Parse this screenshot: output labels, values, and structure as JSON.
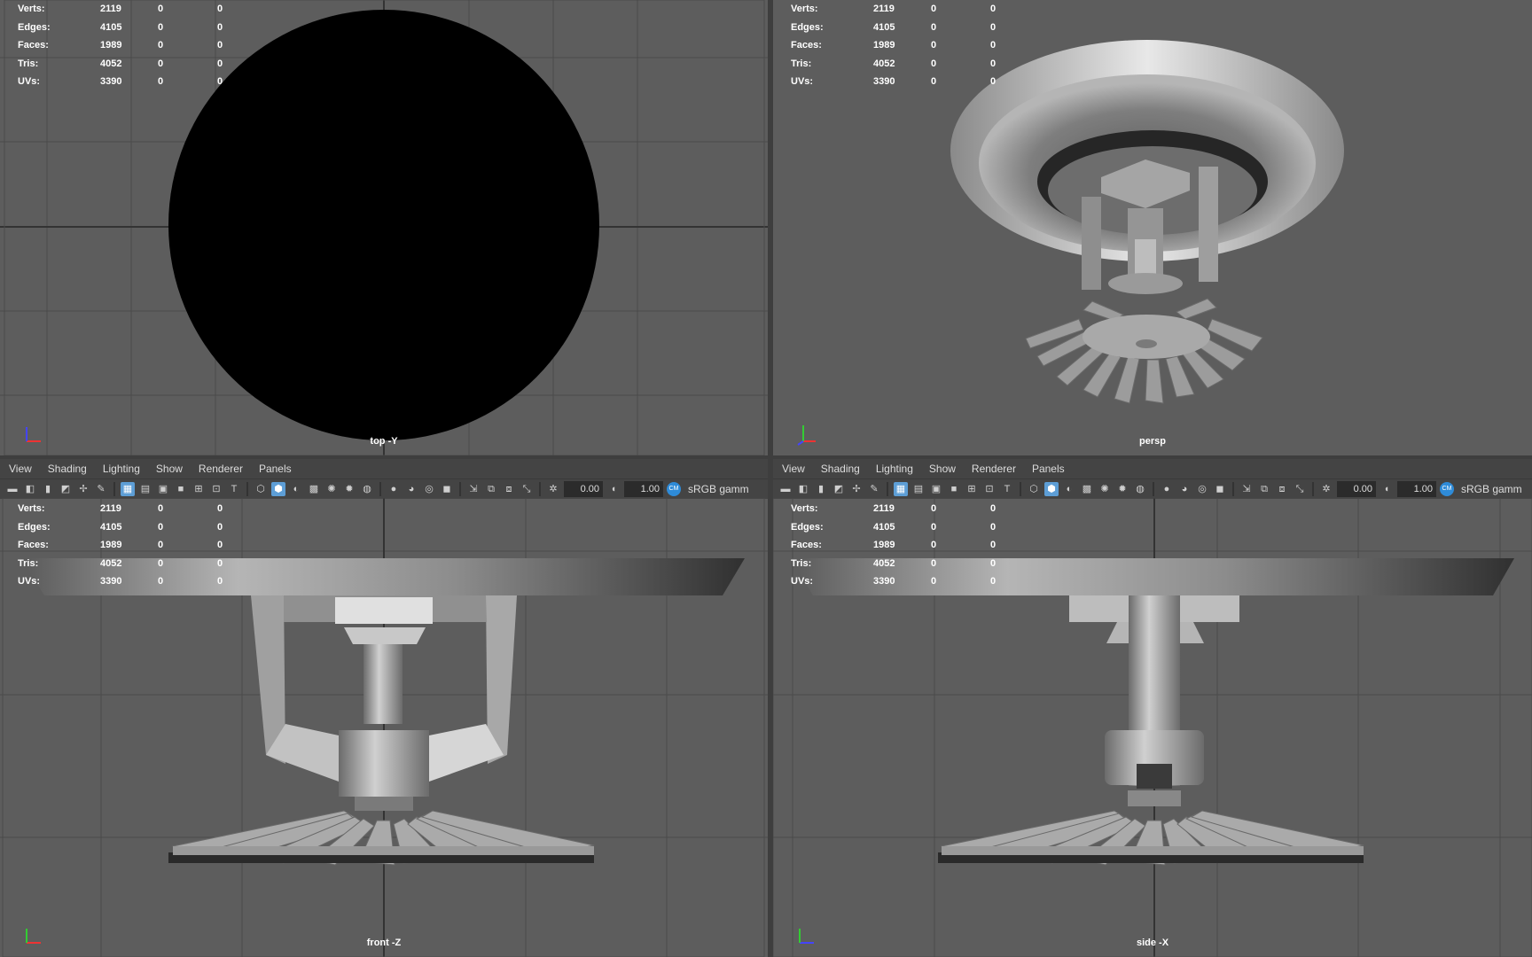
{
  "menu": {
    "view": "View",
    "shading": "Shading",
    "lighting": "Lighting",
    "show": "Show",
    "renderer": "Renderer",
    "panels": "Panels"
  },
  "toolbar": {
    "exposure": "0.00",
    "gamma": "1.00",
    "color_space": "sRGB gamm",
    "cm_badge": "CM"
  },
  "hud": {
    "labels": [
      "Verts:",
      "Edges:",
      "Faces:",
      "Tris:",
      "UVs:"
    ],
    "values": [
      [
        "2119",
        "0",
        "0"
      ],
      [
        "4105",
        "0",
        "0"
      ],
      [
        "1989",
        "0",
        "0"
      ],
      [
        "4052",
        "0",
        "0"
      ],
      [
        "3390",
        "0",
        "0"
      ]
    ]
  },
  "panes": {
    "top_left": {
      "camera": "top -Y"
    },
    "top_right": {
      "camera": "persp"
    },
    "bottom_left": {
      "camera": "front -Z"
    },
    "bottom_right": {
      "camera": "side -X"
    }
  },
  "colors": {
    "viewport_bg": "#5d5d5d",
    "grid_line": "#4a4a4a",
    "grid_axis": "#333333",
    "ui_bg": "#444444",
    "accent": "#5d9ed6"
  },
  "icons": [
    "camera-icon",
    "grid-icon",
    "wireframe-icon",
    "smooth-shade-icon",
    "texture-icon",
    "light-icon",
    "isolate-icon",
    "exposure-icon",
    "gamma-icon"
  ]
}
